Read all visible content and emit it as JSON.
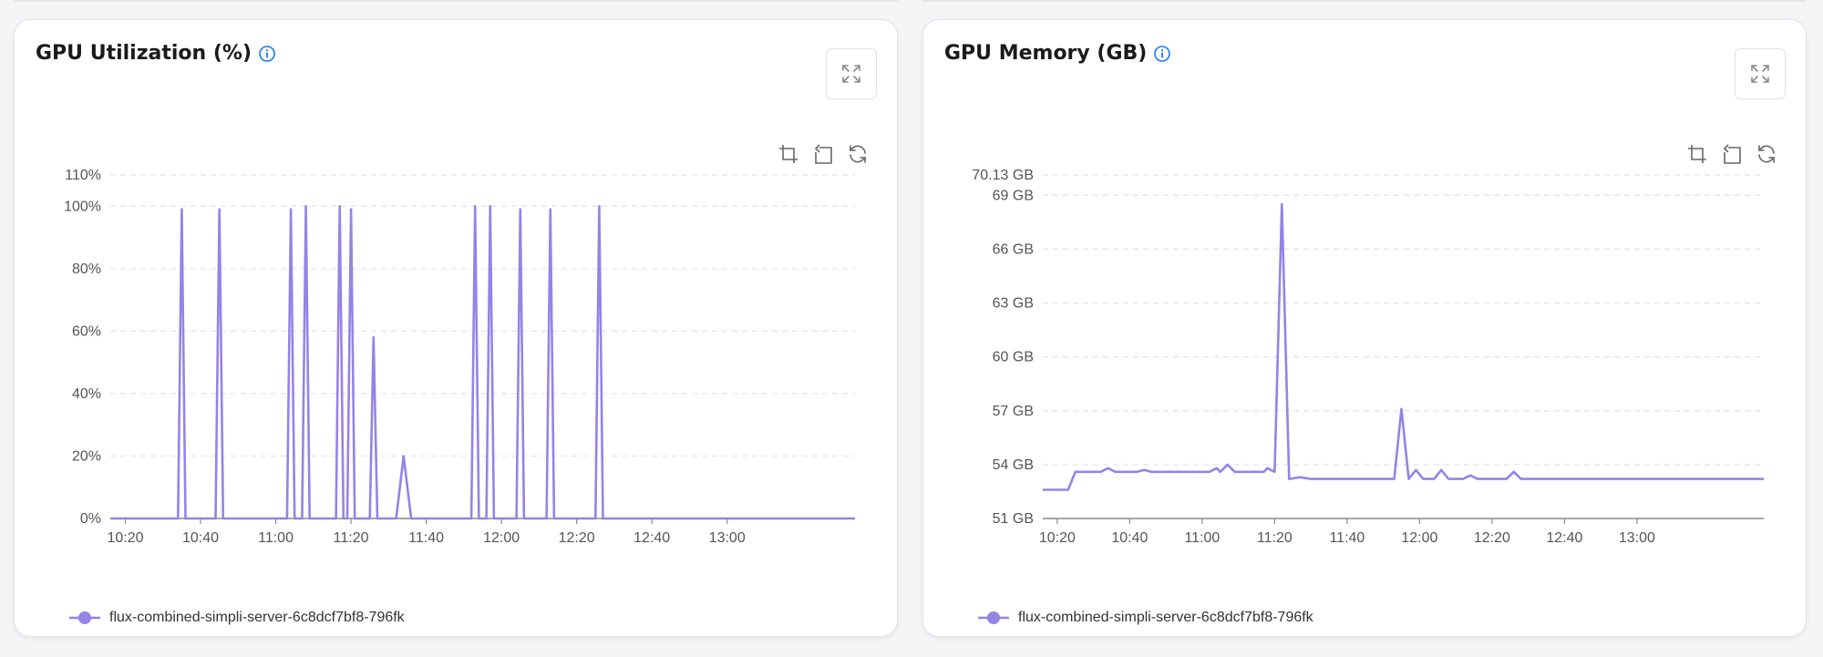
{
  "colors": {
    "series": "#9583e7",
    "grid": "#e3e3ea",
    "axis": "#8a8a8a",
    "info": "#1677ff",
    "icon": "#666666"
  },
  "panels": [
    {
      "title": "GPU Utilization (%)",
      "legend": "flux-combined-simpli-server-6c8dcf7bf8-796fk"
    },
    {
      "title": "GPU Memory (GB)",
      "legend": "flux-combined-simpli-server-6c8dcf7bf8-796fk"
    }
  ],
  "chart_data": [
    {
      "type": "line",
      "title": "GPU Utilization (%)",
      "xlabel": "",
      "ylabel": "",
      "x_ticks": [
        "10:20",
        "10:40",
        "11:00",
        "11:20",
        "11:40",
        "12:00",
        "12:20",
        "12:40",
        "13:00"
      ],
      "y_ticks": [
        "0%",
        "20%",
        "40%",
        "60%",
        "80%",
        "100%",
        "110%"
      ],
      "ylim": [
        0,
        110
      ],
      "xlim": [
        "10:16",
        "13:34"
      ],
      "grid": true,
      "legend_position": "bottom-left",
      "series": [
        {
          "name": "flux-combined-simpli-server-6c8dcf7bf8-796fk",
          "points": [
            [
              "10:16",
              0
            ],
            [
              "10:34",
              0
            ],
            [
              "10:35",
              99
            ],
            [
              "10:36",
              0
            ],
            [
              "10:44",
              0
            ],
            [
              "10:45",
              99
            ],
            [
              "10:46",
              0
            ],
            [
              "11:03",
              0
            ],
            [
              "11:04",
              99
            ],
            [
              "11:05",
              0
            ],
            [
              "11:07",
              0
            ],
            [
              "11:08",
              100
            ],
            [
              "11:09",
              0
            ],
            [
              "11:16",
              0
            ],
            [
              "11:17",
              100
            ],
            [
              "11:18",
              0
            ],
            [
              "11:19",
              0
            ],
            [
              "11:20",
              99
            ],
            [
              "11:21",
              0
            ],
            [
              "11:25",
              0
            ],
            [
              "11:26",
              58
            ],
            [
              "11:27",
              0
            ],
            [
              "11:32",
              0
            ],
            [
              "11:34",
              20
            ],
            [
              "11:36",
              0
            ],
            [
              "11:52",
              0
            ],
            [
              "11:53",
              100
            ],
            [
              "11:54",
              0
            ],
            [
              "11:56",
              0
            ],
            [
              "11:57",
              100
            ],
            [
              "11:58",
              0
            ],
            [
              "12:04",
              0
            ],
            [
              "12:05",
              99
            ],
            [
              "12:06",
              0
            ],
            [
              "12:12",
              0
            ],
            [
              "12:13",
              99
            ],
            [
              "12:14",
              0
            ],
            [
              "12:25",
              0
            ],
            [
              "12:26",
              100
            ],
            [
              "12:27",
              0
            ],
            [
              "13:34",
              0
            ]
          ]
        }
      ]
    },
    {
      "type": "line",
      "title": "GPU Memory (GB)",
      "xlabel": "",
      "ylabel": "",
      "x_ticks": [
        "10:20",
        "10:40",
        "11:00",
        "11:20",
        "11:40",
        "12:00",
        "12:20",
        "12:40",
        "13:00"
      ],
      "y_ticks": [
        "51 GB",
        "54 GB",
        "57 GB",
        "60 GB",
        "63 GB",
        "66 GB",
        "69 GB",
        "70.13 GB"
      ],
      "ylim": [
        51,
        70.13
      ],
      "xlim": [
        "10:16",
        "13:35"
      ],
      "grid": true,
      "legend_position": "bottom-left",
      "series": [
        {
          "name": "flux-combined-simpli-server-6c8dcf7bf8-796fk",
          "points": [
            [
              "10:16",
              52.6
            ],
            [
              "10:23",
              52.6
            ],
            [
              "10:25",
              53.6
            ],
            [
              "10:32",
              53.6
            ],
            [
              "10:34",
              53.8
            ],
            [
              "10:36",
              53.6
            ],
            [
              "10:42",
              53.6
            ],
            [
              "10:44",
              53.7
            ],
            [
              "10:46",
              53.6
            ],
            [
              "11:02",
              53.6
            ],
            [
              "11:04",
              53.8
            ],
            [
              "11:05",
              53.6
            ],
            [
              "11:07",
              54.0
            ],
            [
              "11:09",
              53.6
            ],
            [
              "11:17",
              53.6
            ],
            [
              "11:18",
              53.8
            ],
            [
              "11:20",
              53.6
            ],
            [
              "11:22",
              68.5
            ],
            [
              "11:24",
              53.2
            ],
            [
              "11:27",
              53.3
            ],
            [
              "11:30",
              53.2
            ],
            [
              "11:53",
              53.2
            ],
            [
              "11:55",
              57.1
            ],
            [
              "11:57",
              53.2
            ],
            [
              "11:59",
              53.7
            ],
            [
              "12:01",
              53.2
            ],
            [
              "12:04",
              53.2
            ],
            [
              "12:06",
              53.7
            ],
            [
              "12:08",
              53.2
            ],
            [
              "12:12",
              53.2
            ],
            [
              "12:14",
              53.4
            ],
            [
              "12:16",
              53.2
            ],
            [
              "12:24",
              53.2
            ],
            [
              "12:26",
              53.6
            ],
            [
              "12:28",
              53.2
            ],
            [
              "13:35",
              53.2
            ]
          ]
        }
      ]
    }
  ]
}
